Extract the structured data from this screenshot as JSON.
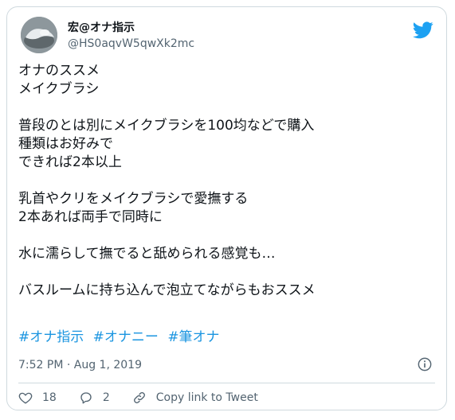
{
  "user": {
    "display_name": "宏@オナ指示",
    "handle": "@HS0aqvW5qwXk2mc",
    "avatar_icon": "avatar-image"
  },
  "tweet": {
    "lines": [
      "オナのススメ",
      "メイクブラシ",
      "",
      "普段のとは別にメイクブラシを100均などで購入",
      "種類はお好みで",
      "できれば2本以上",
      "",
      "乳首やクリをメイクブラシで愛撫する",
      "2本あれば両手で同時に",
      "",
      "水に濡らして撫でると舐められる感覚も…",
      "",
      "バスルームに持ち込んで泡立てながらもおススメ"
    ],
    "hashtags": [
      "#オナ指示",
      "#オナニー",
      "#筆オナ"
    ],
    "timestamp": "7:52 PM · Aug 1, 2019"
  },
  "actions": {
    "like_count": "18",
    "reply_count": "2",
    "copy_link_label": "Copy link to Tweet"
  },
  "colors": {
    "twitter_blue": "#1da1f2",
    "hashtag": "#1b95e0",
    "like_red": "#e0245e",
    "muted": "#536471",
    "border": "#cfd9de"
  }
}
